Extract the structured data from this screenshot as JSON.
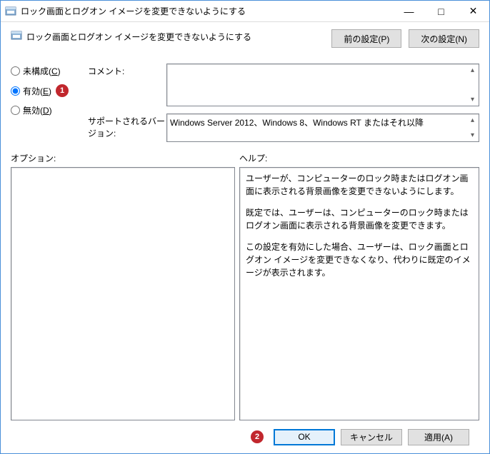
{
  "titlebar": {
    "title": "ロック画面とログオン イメージを変更できないようにする"
  },
  "header": {
    "title": "ロック画面とログオン イメージを変更できないようにする"
  },
  "nav": {
    "prev_label": "前の設定(P)",
    "next_label": "次の設定(N)"
  },
  "radios": {
    "not_configured": "未構成(C)",
    "enabled": "有効(E)",
    "disabled": "無効(D)",
    "selected": "enabled"
  },
  "annotations": {
    "badge1": "1",
    "badge2": "2"
  },
  "fields": {
    "comment_label": "コメント:",
    "comment_value": "",
    "supported_label": "サポートされるバージョン:",
    "supported_value": "Windows Server 2012、Windows 8、Windows RT またはそれ以降"
  },
  "labels": {
    "options": "オプション:",
    "help": "ヘルプ:"
  },
  "help": {
    "p1": "ユーザーが、コンピューターのロック時またはログオン画面に表示される背景画像を変更できないようにします。",
    "p2": "既定では、ユーザーは、コンピューターのロック時またはログオン画面に表示される背景画像を変更できます。",
    "p3": "この設定を有効にした場合、ユーザーは、ロック画面とログオン イメージを変更できなくなり、代わりに既定のイメージが表示されます。"
  },
  "footer": {
    "ok": "OK",
    "cancel": "キャンセル",
    "apply": "適用(A)"
  }
}
